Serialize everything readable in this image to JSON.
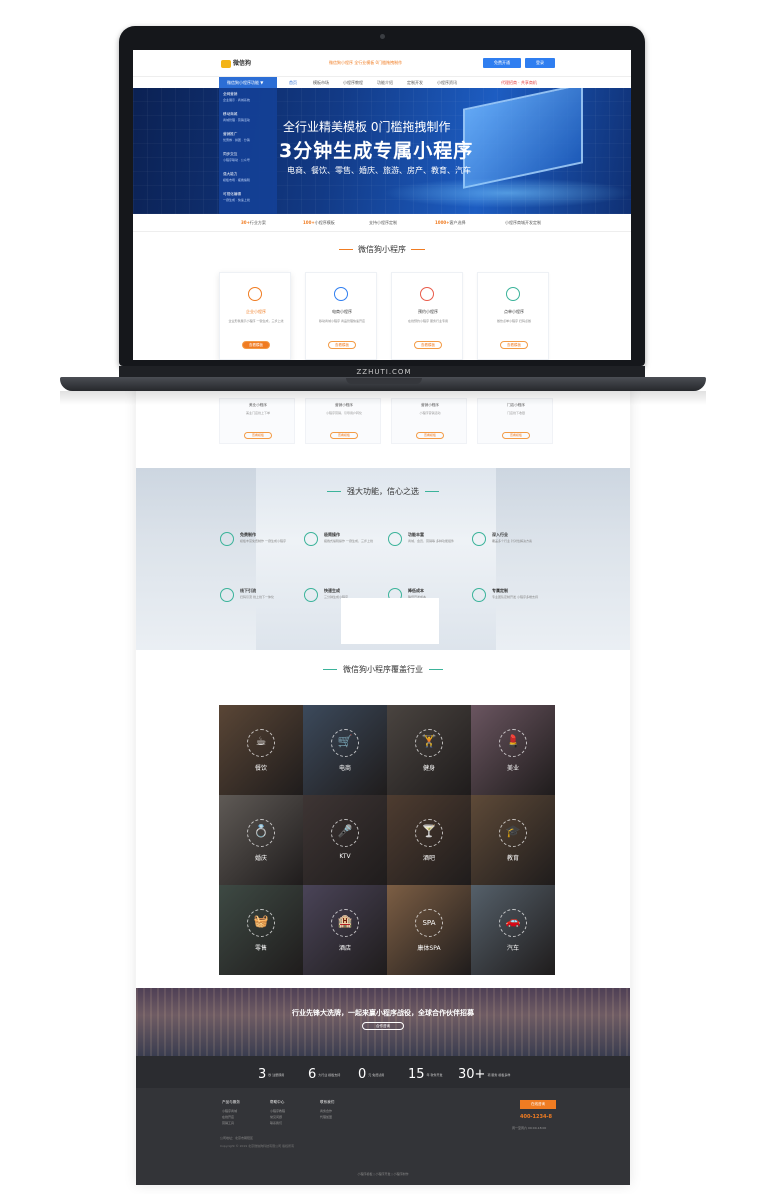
{
  "laptop_label": "ZZHUTI.COM",
  "header": {
    "logo": "微信狗",
    "promo": "微信狗小程序 全行业模板 0门槛拖拽制作",
    "login_label": "免费开通",
    "register_label": "登录"
  },
  "nav": {
    "category_label": "微信狗小程序功能 ▼",
    "items": [
      "首页",
      "模板市场",
      "小程序教程",
      "功能介绍",
      "定制开发",
      "小程序资讯"
    ],
    "right_text": "代理招商 · 共享商机"
  },
  "category_menu": [
    {
      "title": "全网营销",
      "sub": "企业展示 · 商城系统"
    },
    {
      "title": "移动商城",
      "sub": "商城管理 · 营销活动"
    },
    {
      "title": "营销推广",
      "sub": "优惠券 · 拼团 · 分销"
    },
    {
      "title": "同步交互",
      "sub": "小程序联动 · 公众号"
    },
    {
      "title": "强大能力",
      "sub": "模板市场 · 拖拽编辑"
    },
    {
      "title": "可视化编辑",
      "sub": "一键生成 · 快速上线"
    }
  ],
  "banner": {
    "line1": "全行业精美模板  0门槛拖拽制作",
    "line2": "3分钟生成专属小程序",
    "line3": "电商、餐饮、零售、婚庆、旅游、房产、教育、汽车"
  },
  "features": [
    {
      "num": "30+",
      "text": "行业方案"
    },
    {
      "num": "100+",
      "text": "小程序模板"
    },
    {
      "num": "",
      "text": "支持小程序定制"
    },
    {
      "num": "1000+",
      "text": "客户选择"
    },
    {
      "num": "",
      "text": "小程序商城开发定制"
    }
  ],
  "products_section": {
    "title": "微信狗小程序",
    "cards": [
      {
        "name": "企业小程序",
        "desc": "企业形象展示小程序 一键生成，三步上线",
        "btn": "查看模板"
      },
      {
        "name": "电商小程序",
        "desc": "移动商城小程序 商品管理快速开店",
        "btn": "查看模板"
      },
      {
        "name": "预约小程序",
        "desc": "在线预约小程序 服务行业专用",
        "btn": "查看模板"
      },
      {
        "name": "点单小程序",
        "desc": "餐饮点单小程序 扫码点餐",
        "btn": "查看模板"
      }
    ],
    "lower_cards": [
      {
        "name": "美业小程序",
        "desc": "美业门店线上下单",
        "btn": "查看模板"
      },
      {
        "name": "营销小程序",
        "desc": "小程序营销，引导用户转化",
        "btn": "查看模板"
      },
      {
        "name": "营销小程序",
        "desc": "小程序营销活动",
        "btn": "查看模板"
      },
      {
        "name": "门店小程序",
        "desc": "门店线下收银",
        "btn": "查看模板"
      }
    ]
  },
  "functions": {
    "title": "强大功能，信心之选",
    "items": [
      {
        "title": "免费制作",
        "desc": "模板丰富免费制作 一键生成小程序"
      },
      {
        "title": "极简操作",
        "desc": "拖拽式编辑操作 一键生成，三步上线"
      },
      {
        "title": "功能丰富",
        "desc": "商城、会员、营销等 多种功能组件"
      },
      {
        "title": "深入行业",
        "desc": "覆盖多个行业 针对性解决方案"
      },
      {
        "title": "线下引流",
        "desc": "扫码引流 线上线下一体化"
      },
      {
        "title": "快速生成",
        "desc": "三分钟生成小程序"
      },
      {
        "title": "降低成本",
        "desc": "降低开发成本"
      },
      {
        "title": "专属定制",
        "desc": "专业团队定制开发 小程序多端支持"
      }
    ]
  },
  "industries": {
    "title": "微信狗小程序覆盖行业",
    "tiles": [
      {
        "label": "餐饮",
        "glyph": "☕",
        "color": "#5a4636"
      },
      {
        "label": "电商",
        "glyph": "🛒",
        "color": "#3c4a5c"
      },
      {
        "label": "健身",
        "glyph": "🏋",
        "color": "#4a4440"
      },
      {
        "label": "美业",
        "glyph": "💄",
        "color": "#6a5560"
      },
      {
        "label": "婚庆",
        "glyph": "💍",
        "color": "#5f5a56"
      },
      {
        "label": "KTV",
        "glyph": "🎤",
        "color": "#3e3534"
      },
      {
        "label": "酒吧",
        "glyph": "🍸",
        "color": "#4e3c30"
      },
      {
        "label": "教育",
        "glyph": "🎓",
        "color": "#5e4a38"
      },
      {
        "label": "零售",
        "glyph": "🧺",
        "color": "#3e4a44"
      },
      {
        "label": "酒店",
        "glyph": "🏨",
        "color": "#4a4458"
      },
      {
        "label": "康体SPA",
        "glyph": "SPA",
        "color": "#7c5e44"
      },
      {
        "label": "汽车",
        "glyph": "🚗",
        "color": "#55606a"
      }
    ]
  },
  "partner": {
    "text": "行业先锋大洗牌，一起来赢小程序战役，全球合作伙伴招募",
    "btn": "合作咨询"
  },
  "stats": [
    {
      "num": "3",
      "label": "秒 注册即用"
    },
    {
      "num": "6",
      "label": "大行业 模板支持"
    },
    {
      "num": "0",
      "label": "元 免费试用"
    },
    {
      "num": "15",
      "label": "年 软件开发"
    },
    {
      "num": "30+",
      "label": "项 服务 模板多样"
    }
  ],
  "footer": {
    "cols": [
      {
        "h": "产品与服务",
        "items": [
          "小程序商城",
          "在线开店",
          "营销工具"
        ]
      },
      {
        "h": "帮助中心",
        "items": [
          "小程序教程",
          "常见问题",
          "联系我们"
        ]
      },
      {
        "h": "联系我们",
        "items": [
          "商务合作",
          "代理加盟"
        ]
      }
    ],
    "btn": "在线咨询",
    "phone": "400-1234-8",
    "time": "周一至周六 09:00-18:00",
    "addr": "公司地址：北京市朝阳区",
    "copyright": "Copyright © 2019 北京微信狗科技有限公司 版权所有",
    "links": [
      "小程序模板",
      "|",
      "小程序开发",
      "|",
      "小程序制作"
    ]
  }
}
